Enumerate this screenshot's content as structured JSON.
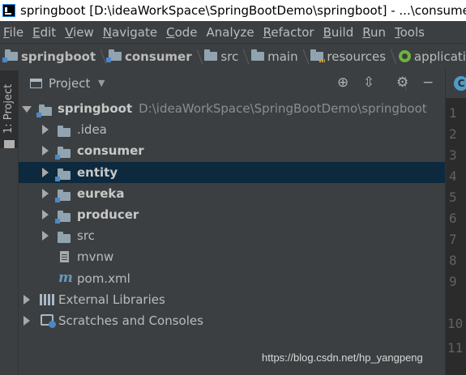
{
  "window": {
    "title": "springboot [D:\\ideaWorkSpace\\SpringBootDemo\\springboot] - ...\\consumer"
  },
  "menu": {
    "items": [
      {
        "mnemonic": "F",
        "rest": "ile"
      },
      {
        "mnemonic": "E",
        "rest": "dit"
      },
      {
        "mnemonic": "V",
        "rest": "iew"
      },
      {
        "mnemonic": "N",
        "rest": "avigate"
      },
      {
        "mnemonic": "C",
        "rest": "ode"
      },
      {
        "mnemonic": "",
        "rest": "Analyze"
      },
      {
        "mnemonic": "R",
        "rest": "efactor"
      },
      {
        "mnemonic": "B",
        "rest": "uild"
      },
      {
        "mnemonic": "R",
        "rest": "un"
      },
      {
        "mnemonic": "T",
        "rest": "ools"
      }
    ]
  },
  "breadcrumb": {
    "items": [
      {
        "label": "springboot",
        "icon": "module-folder-icon"
      },
      {
        "label": "consumer",
        "icon": "module-folder-icon"
      },
      {
        "label": "src",
        "icon": "folder-icon"
      },
      {
        "label": "main",
        "icon": "folder-icon"
      },
      {
        "label": "resources",
        "icon": "resources-folder-icon"
      },
      {
        "label": "applicati",
        "icon": "spring-icon"
      }
    ]
  },
  "tool_stripe": {
    "project_tab": "1: Project"
  },
  "project_panel": {
    "title": "Project",
    "tools": [
      "locate-icon",
      "collapse-all-icon",
      "settings-icon",
      "hide-icon"
    ],
    "tree": {
      "root": {
        "name": "springboot",
        "path": "D:\\ideaWorkSpace\\SpringBootDemo\\springboot"
      },
      "children": [
        {
          "name": ".idea",
          "type": "folder",
          "bold": false
        },
        {
          "name": "consumer",
          "type": "module",
          "bold": true
        },
        {
          "name": "entity",
          "type": "module",
          "bold": true,
          "selected": true
        },
        {
          "name": "eureka",
          "type": "module",
          "bold": true
        },
        {
          "name": "producer",
          "type": "module",
          "bold": true
        },
        {
          "name": "src",
          "type": "folder",
          "bold": false
        },
        {
          "name": "mvnw",
          "type": "file"
        },
        {
          "name": "pom.xml",
          "type": "maven"
        }
      ],
      "external_libraries": "External Libraries",
      "scratches": "Scratches and Consoles"
    }
  },
  "editor": {
    "tab_icon_letter": "C",
    "line_numbers": [
      "1",
      "2",
      "3",
      "4",
      "5",
      "6",
      "7",
      "8",
      "9",
      "10",
      "11"
    ]
  },
  "watermark": "https://blog.csdn.net/hp_yangpeng",
  "colors": {
    "selection": "#0d293e",
    "panel": "#3c3f41",
    "editor": "#2b2b2b"
  }
}
